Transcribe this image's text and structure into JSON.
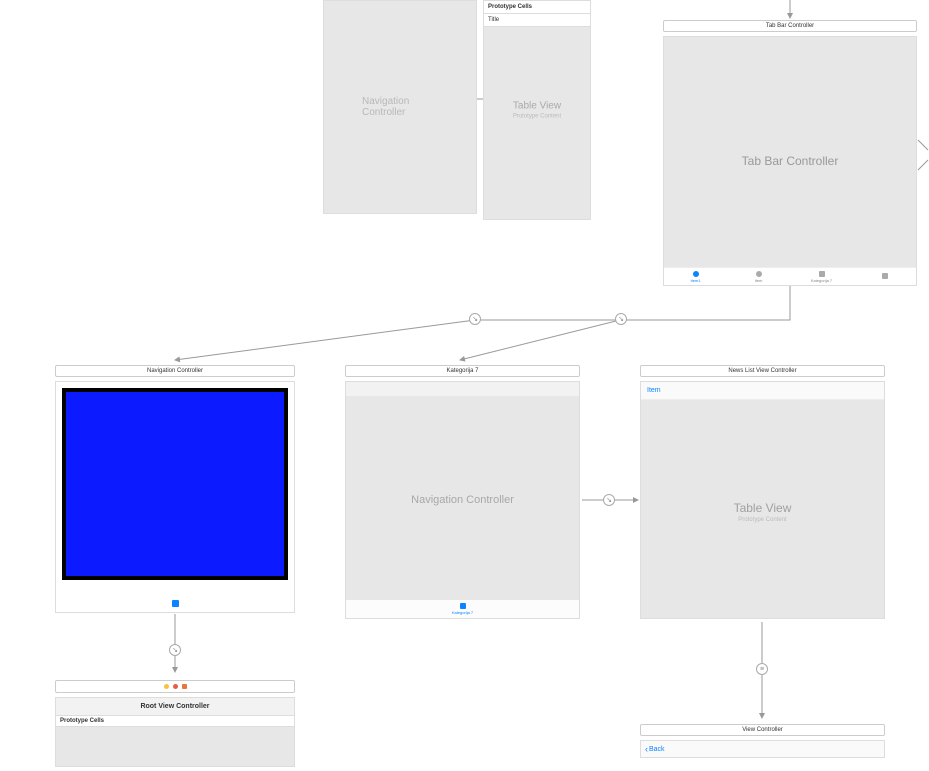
{
  "scenes": {
    "navTop": {
      "label": "Navigation Controller"
    },
    "tableTop": {
      "protoHeader": "Prototype Cells",
      "protoRow": "Title",
      "centerTitle": "Table View",
      "centerSub": "Prototype Content"
    },
    "tabBar": {
      "title": "Tab Bar Controller",
      "centerTitle": "Tab Bar Controller",
      "items": [
        {
          "label": "Item1",
          "icon": "circle",
          "active": true
        },
        {
          "label": "Item",
          "icon": "circle",
          "active": false
        },
        {
          "label": "Kategorija 7",
          "icon": "square",
          "active": false
        },
        {
          "label": "",
          "icon": "square",
          "active": false
        }
      ]
    },
    "navBlue": {
      "title": "Navigation Controller"
    },
    "rootVc": {
      "header": "Root View Controller",
      "proto": "Prototype Cells"
    },
    "kat": {
      "title": "Kategorija 7",
      "centerTitle": "Navigation Controller",
      "tabLabel": "Kategorija 7"
    },
    "news": {
      "title": "News List View Controller",
      "navItem": "Item",
      "centerTitle": "Table View",
      "centerSub": "Prototype Content"
    },
    "vc": {
      "title": "View Controller",
      "back": "Back"
    }
  }
}
